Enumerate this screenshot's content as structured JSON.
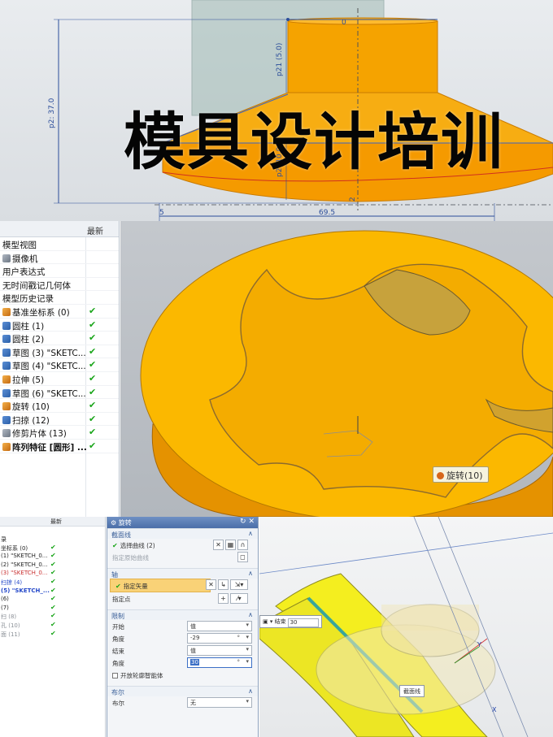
{
  "drawing": {
    "dim_top_diameter": "p21 (5.0)",
    "dim_overall_height": "p2: 37.0",
    "dim_flange_thickness": "p2: 10.0",
    "dim_gap": "5",
    "dim_offset": "2",
    "dim_width": "69.5",
    "dim_bottom": "0"
  },
  "part_navigator": {
    "header_latest": "最新",
    "rows": [
      {
        "label": "模型视图",
        "check": ""
      },
      {
        "label": "摄像机",
        "check": ""
      },
      {
        "label": "用户表达式",
        "check": ""
      },
      {
        "label": "无时间戳记几何体",
        "check": ""
      },
      {
        "label": "模型历史记录",
        "check": ""
      },
      {
        "label": "基准坐标系 (0)",
        "check": "✔"
      },
      {
        "label": "圆柱 (1)",
        "check": "✔"
      },
      {
        "label": "圆柱 (2)",
        "check": "✔"
      },
      {
        "label": "草图 (3) \"SKETC...",
        "check": "✔"
      },
      {
        "label": "草图 (4) \"SKETC...",
        "check": "✔"
      },
      {
        "label": "拉伸 (5)",
        "check": "✔"
      },
      {
        "label": "草图 (6) \"SKETC...",
        "check": "✔"
      },
      {
        "label": "旋转 (10)",
        "check": "✔"
      },
      {
        "label": "扫掠 (12)",
        "check": "✔"
      },
      {
        "label": "修剪片体 (13)",
        "check": "✔"
      },
      {
        "label": "阵列特征 [圆形] ...",
        "check": "✔"
      }
    ]
  },
  "overlay_title": "模具设计培训",
  "tooltip": "旋转(10)",
  "mini_tree": {
    "header_latest": "最新",
    "rows": [
      {
        "label": "录",
        "check": ""
      },
      {
        "label": "坐标系 (0)",
        "check": "✔"
      },
      {
        "label": "(1) \"SKETCH_0...",
        "check": "✔"
      },
      {
        "label": "(2) \"SKETCH_0...",
        "check": "✔"
      },
      {
        "label": "(3) \"SKETCH_0...",
        "check": "✔"
      },
      {
        "label": "扫掠 (4)",
        "check": "✔"
      },
      {
        "label": "(5) \"SKETCH_...",
        "check": "✔"
      },
      {
        "label": "(6)",
        "check": "✔"
      },
      {
        "label": "(7)",
        "check": "✔"
      },
      {
        "label": "扫 (8)",
        "check": "✔"
      },
      {
        "label": "孔 (10)",
        "check": "✔"
      },
      {
        "label": "面 (11)",
        "check": "✔"
      }
    ]
  },
  "revolve_dialog": {
    "title": "旋转",
    "section_curve": "截面线",
    "select_curve": "选择曲线 (2)",
    "specify_origin_curve": "指定原始曲线",
    "axis": "轴",
    "specify_vector": "指定矢量",
    "specify_point": "指定点",
    "limits": "限制",
    "start": "开始",
    "start_value": "值",
    "angle": "角度",
    "start_angle": "-29",
    "end": "结束",
    "end_value": "值",
    "end_angle": "30",
    "angle_unit": "°",
    "open_profile": "开放轮廓智能体",
    "boolean": "布尔",
    "boolean_label": "布尔",
    "boolean_value": "无"
  },
  "view3d": {
    "end_label": "结束",
    "end_value": "30",
    "section_chip": "截面线"
  },
  "colors": {
    "part_yellow": "#f7b500",
    "part_orange": "#f59a00",
    "dim_blue": "#2b4d9a",
    "check_green": "#1aa51a",
    "highlight": "#f9d277"
  }
}
